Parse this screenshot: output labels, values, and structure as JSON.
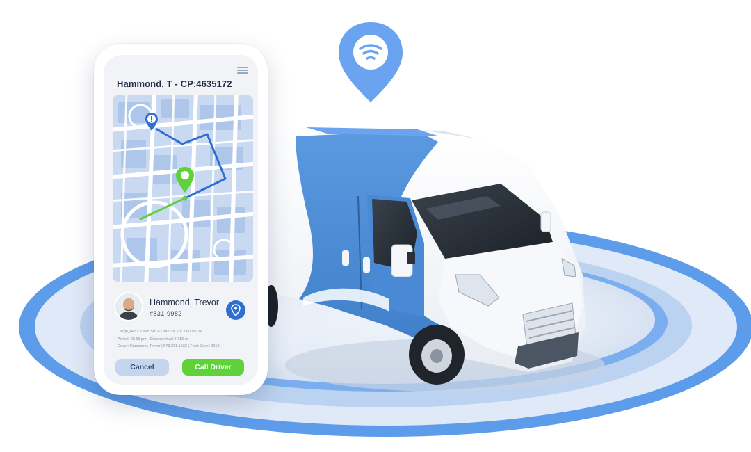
{
  "tracking_card": {
    "title": "Hammond, T - CP:4635172",
    "driver": {
      "name": "Hammond, Trevor",
      "id": "#831-9982"
    },
    "details": [
      "Cargo_0451: Dest: 50° 43.3421\"N 20° 74.0060\"W",
      "Arrival: 08.55 pm - Distance load 6.713 mi",
      "Driver: Hammond, Trevor | 573.231.1532 | Fleet Driver 2019"
    ],
    "buttons": {
      "cancel": "Cancel",
      "call": "Call Driver"
    }
  },
  "icons": {
    "menu": "hamburger-menu-icon",
    "alert_pin": "exclamation-pin-icon",
    "driver_pin": "green-location-pin-icon",
    "location_button": "location-pin-icon",
    "signal": "wifi-signal-pin-icon"
  },
  "colors": {
    "accent_blue": "#6aa3ef",
    "route_blue": "#2f6fcf",
    "route_green": "#5fd13a",
    "van_blue": "#4d8fd8"
  }
}
